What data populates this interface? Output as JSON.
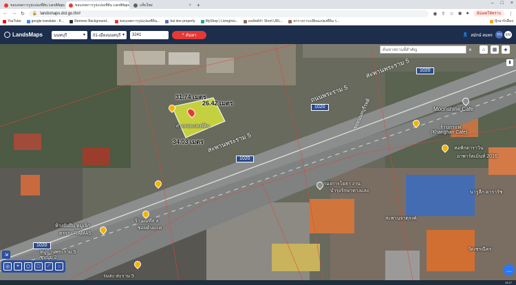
{
  "browser": {
    "tabs": [
      {
        "label": "ขอบเขตการรูปแปลงที่ดิน LandMaps",
        "color": "#e53935",
        "active": false
      },
      {
        "label": "ขอบเขตการรูปแปลงที่ดิน LandMaps",
        "color": "#e53935",
        "active": true
      },
      {
        "label": "แท็บใหม่",
        "color": "#5f6368",
        "active": false
      }
    ],
    "url": "landsmaps.dol.go.th/#",
    "update_label": "อัปเดตให้ทราบ",
    "bookmarks": [
      {
        "label": "YouTube",
        "color": "#ff0000"
      },
      {
        "label": "google translate - K...",
        "color": "#4285f4"
      },
      {
        "label": "Remove Background...",
        "color": "#333333"
      },
      {
        "label": "ขอบเขตการรูปแปลงที่ดิน...",
        "color": "#e53935"
      },
      {
        "label": "bai dee property",
        "color": "#5c6bc0"
      },
      {
        "label": "MyShop | LivingInsi...",
        "color": "#26a69a"
      },
      {
        "label": "ผลลัพธ์ทำ Short URL...",
        "color": "#8d6e63"
      },
      {
        "label": "ตารางการเปลี่ยนแปลงที่ดิน ร...",
        "color": "#8d6e63"
      }
    ],
    "bookmarks_other": "บุ๊กมาร์กอื่นๆ"
  },
  "app": {
    "name": "LandsMaps",
    "province": "นนทบุรี",
    "district": "01-เมืองนนทบุรี",
    "parcel_no": "3241",
    "search_label": "ค้นหา",
    "user": "สมักษ์ สมพร",
    "lang_th": "TH",
    "lang_en": "EN"
  },
  "map": {
    "search_placeholder": "ค้นหาสถานที่สำคัญ",
    "measures": {
      "top_left": "31.74 เมตร",
      "top_right": "26.42 เมตร",
      "bottom": "34.03 เมตร"
    },
    "parcel_label": "ตำแหน่งแปลงที่ดิน",
    "road_name_1": "สะพานพระราม 5",
    "road_name_2": "สะพานพระราม 5",
    "road_name_3": "ถนนพระราม 5",
    "road_name_4": "ซอยนนทบุรีรทดิ",
    "shields": [
      "1020",
      "1020",
      "1020",
      "1020"
    ],
    "places": [
      "Moonshine Cafe",
      "ร้านกาแฟ",
      "(Khanghan Cafe)",
      "หอพักดาราวิน",
      "อาพาร์ตเม้นท์ 2016",
      "กองการโยธา งาน",
      "บำรุงรักษาทางและ",
      "สะพานจาตุรงค์",
      "ห้างยัยยีน หมู่เล็ก",
      "ตรรกะ RAMA5",
      "ร้านเมทัส ล",
      "ซอยต้นมะค",
      "นารูลีก ดารารัช",
      "วัดเซรณีคร",
      "หมู่บ้านพระราม 5",
      "ชุมนุม 2",
      "ร่มสะ-สะราม 5"
    ]
  },
  "taskbar": {
    "time": "19:17"
  }
}
